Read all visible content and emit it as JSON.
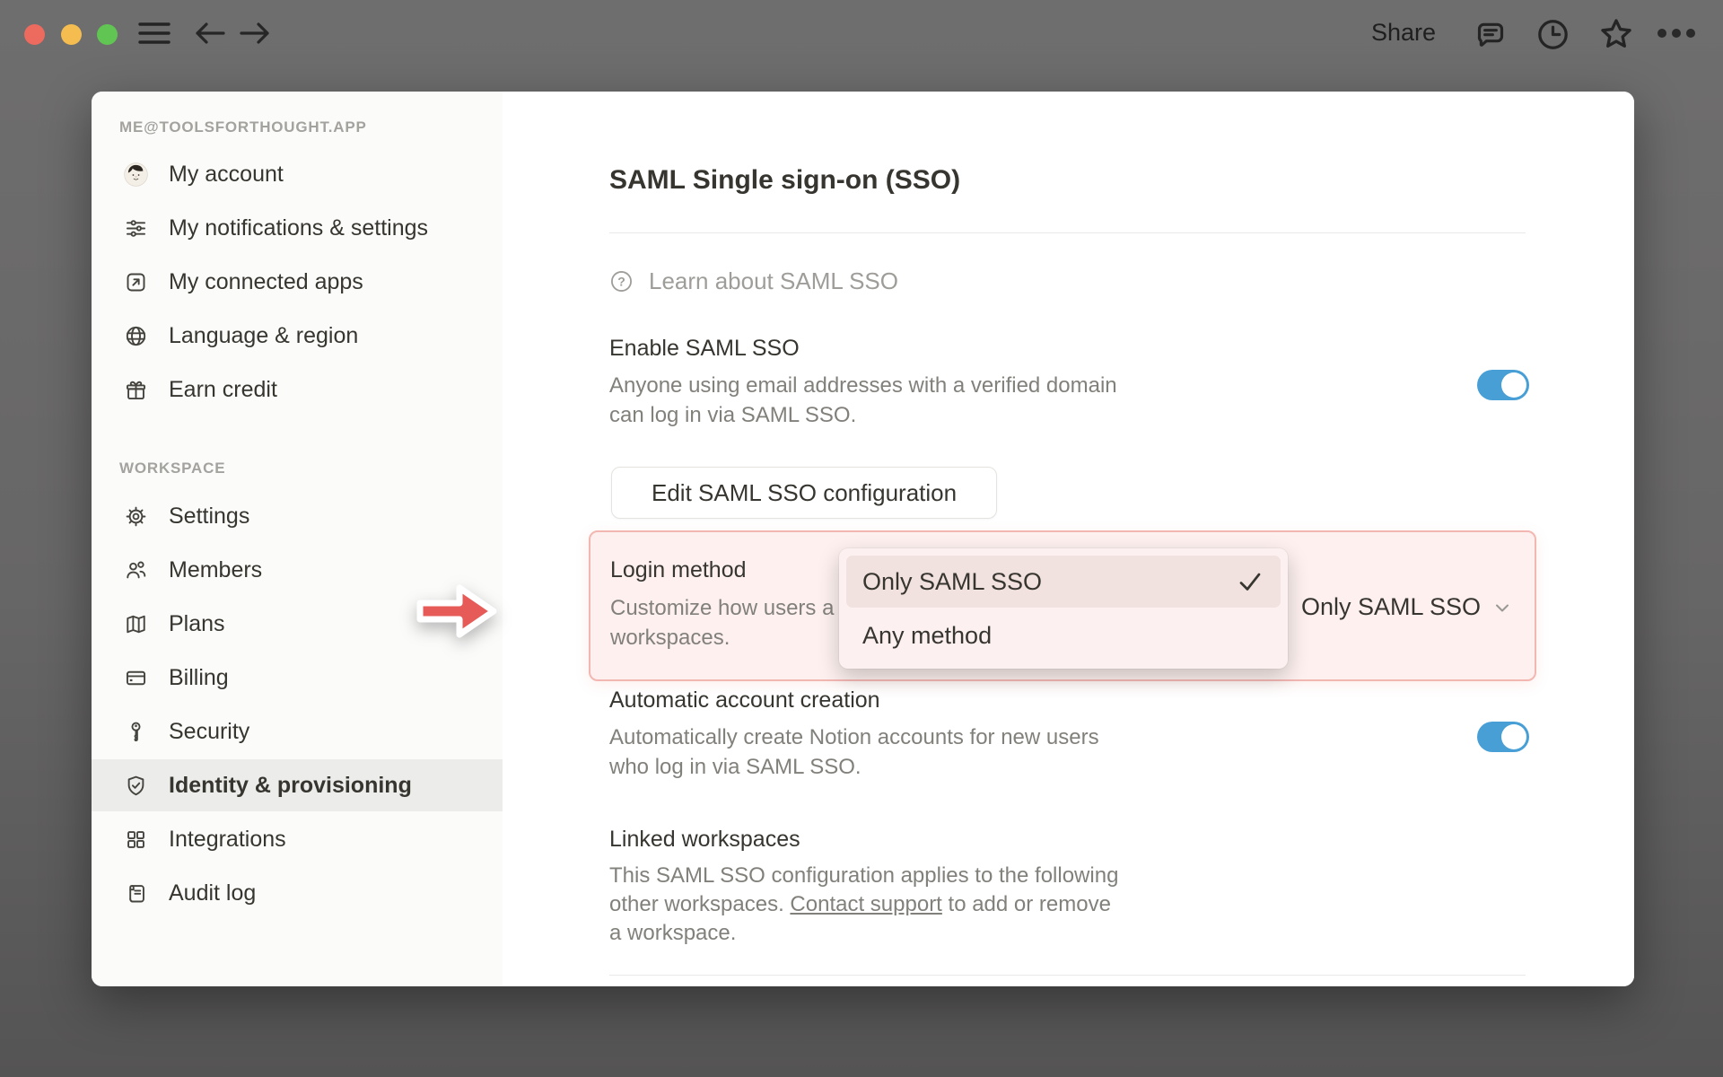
{
  "colors": {
    "accent_toggle_blue": "#489fd5",
    "highlight_pink_bg": "#fdf0ee",
    "highlight_pink_border": "#f3b7b2",
    "arrow_red": "#e65b58",
    "text_primary": "#37352f",
    "text_secondary": "#82807b",
    "text_tertiary": "#9e9d99",
    "sidebar_bg": "#fbfbfa",
    "sidebar_selected_bg": "#ececeb"
  },
  "chrome": {
    "share_label": "Share",
    "icons": [
      "hamburger-icon",
      "back-arrow-icon",
      "forward-arrow-icon",
      "comment-icon",
      "clock-icon",
      "star-icon",
      "ellipsis-icon"
    ]
  },
  "sidebar": {
    "account_email": "ME@TOOLSFORTHOUGHT.APP",
    "workspace_label": "WORKSPACE",
    "account_items": [
      {
        "label": "My account",
        "icon": "avatar"
      },
      {
        "label": "My notifications & settings",
        "icon": "sliders-icon"
      },
      {
        "label": "My connected apps",
        "icon": "external-link-icon"
      },
      {
        "label": "Language & region",
        "icon": "globe-icon"
      },
      {
        "label": "Earn credit",
        "icon": "gift-icon"
      }
    ],
    "workspace_items": [
      {
        "label": "Settings",
        "icon": "gear-icon",
        "selected": false
      },
      {
        "label": "Members",
        "icon": "members-icon",
        "selected": false
      },
      {
        "label": "Plans",
        "icon": "map-icon",
        "selected": false
      },
      {
        "label": "Billing",
        "icon": "credit-card-icon",
        "selected": false
      },
      {
        "label": "Security",
        "icon": "key-icon",
        "selected": false
      },
      {
        "label": "Identity & provisioning",
        "icon": "shield-check-icon",
        "selected": true
      },
      {
        "label": "Integrations",
        "icon": "grid-icon",
        "selected": false
      },
      {
        "label": "Audit log",
        "icon": "scroll-icon",
        "selected": false
      }
    ]
  },
  "main": {
    "title": "SAML Single sign-on (SSO)",
    "learn_link": {
      "label": "Learn about SAML SSO",
      "icon": "question-circle-icon"
    },
    "enable_section": {
      "title": "Enable SAML SSO",
      "description_line1": "Anyone using email addresses with a verified domain",
      "description_line2": "can log in via SAML SSO.",
      "toggle_state": "on"
    },
    "edit_button_label": "Edit SAML SSO configuration",
    "login_method_section": {
      "title": "Login method",
      "description_visible_line1": "Customize how users a",
      "description_visible_line2": "workspaces.",
      "selected_value": "Only SAML SSO",
      "dropdown": {
        "options": [
          {
            "label": "Only SAML SSO",
            "checked": true
          },
          {
            "label": "Any method",
            "checked": false
          }
        ]
      }
    },
    "auto_account_section": {
      "title": "Automatic account creation",
      "description_line1": "Automatically create Notion accounts for new users",
      "description_line2": "who log in via SAML SSO.",
      "toggle_state": "on"
    },
    "linked_section": {
      "title": "Linked workspaces",
      "description_line1": "This SAML SSO configuration applies to the following",
      "description_line2_pre": "other workspaces. ",
      "description_link": "Contact support",
      "description_line2_post": " to add or remove",
      "description_line3": "a workspace."
    }
  }
}
